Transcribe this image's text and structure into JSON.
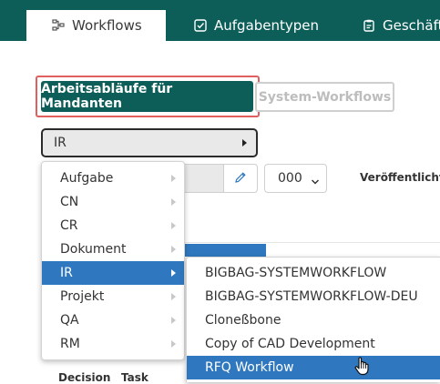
{
  "nav": {
    "tabs": [
      {
        "label": "Workflows",
        "icon": "workflow-icon",
        "active": true
      },
      {
        "label": "Aufgabentypen",
        "icon": "checkbox-icon",
        "active": false
      },
      {
        "label": "Geschäfts",
        "icon": "clipboard-icon",
        "active": false
      }
    ]
  },
  "segments": {
    "tenant_label": "Arbeitsabläufe für Mandanten",
    "system_label": "System-Workflows"
  },
  "cascade": {
    "value": "IR"
  },
  "form": {
    "version_value": "000",
    "published_label": "Veröffentlichte"
  },
  "table": {
    "headers": [
      "Decision",
      "Task"
    ]
  },
  "menu_level1": {
    "items": [
      "Aufgabe",
      "CN",
      "CR",
      "Dokument",
      "IR",
      "Projekt",
      "QA",
      "RM"
    ],
    "selected": "IR"
  },
  "menu_level2": {
    "items": [
      "BIGBAG-SYSTEMWORKFLOW",
      "BIGBAG-SYSTEMWORKFLOW-DEU",
      "Cloneßbone",
      "Copy of CAD Development",
      "RFQ Workflow"
    ],
    "selected": "RFQ Workflow"
  },
  "colors": {
    "brand": "#0d5e59",
    "selection": "#2f77be",
    "highlight": "#e06060"
  }
}
